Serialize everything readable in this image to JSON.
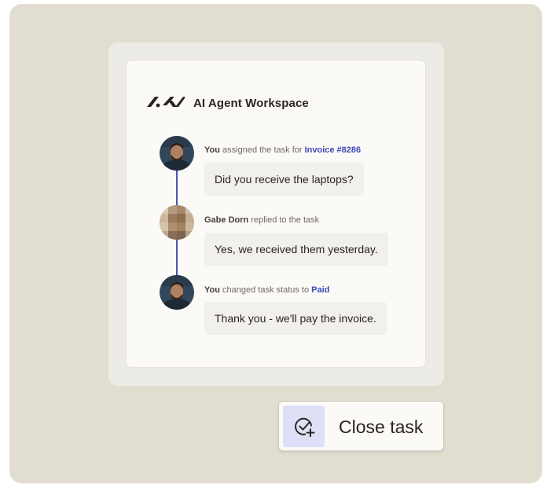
{
  "workspace": {
    "title": "AI Agent Workspace",
    "logo_icon": "ai-agent-logo-icon"
  },
  "timeline": [
    {
      "actor": "You",
      "action": " assigned the task for ",
      "highlight": "Invoice #8286",
      "message": "Did you receive the laptops?",
      "avatar": "user-avatar"
    },
    {
      "actor": "Gabe Dorn",
      "action": " replied to the task",
      "highlight": "",
      "message": "Yes, we received them yesterday.",
      "avatar": "gabe-dorn-avatar-pixelated"
    },
    {
      "actor": "You",
      "action": " changed task status to ",
      "highlight": "Paid",
      "message": "Thank you - we'll pay the invoice.",
      "avatar": "user-avatar"
    }
  ],
  "close_button": {
    "label": "Close task",
    "icon": "check-circle-plus-icon"
  },
  "colors": {
    "backdrop": "#e2ddd1",
    "accent": "#3d49b8",
    "icon_box": "#dde0f7",
    "text": "#2b2522"
  }
}
